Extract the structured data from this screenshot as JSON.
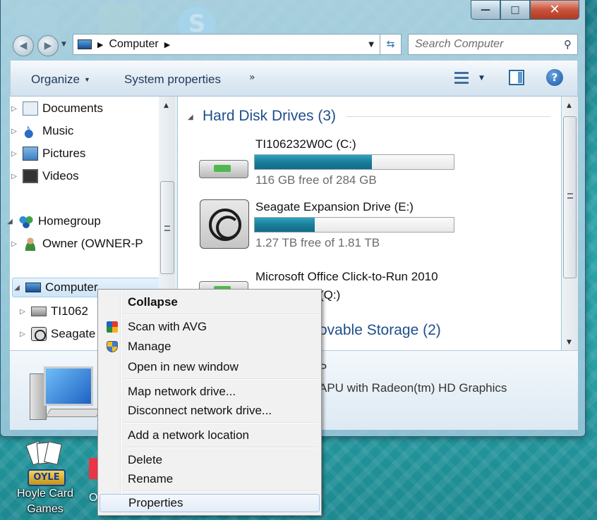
{
  "window": {
    "minimize_glyph": "—",
    "maximize_glyph": "□",
    "close_glyph": "✕"
  },
  "address_bar": {
    "crumbs": [
      "Computer"
    ],
    "search_placeholder": "Search Computer"
  },
  "toolbar": {
    "organize": "Organize",
    "system_properties": "System properties",
    "more": "»"
  },
  "nav_pane": {
    "items": [
      {
        "label": "Documents",
        "icon": "documents-icon"
      },
      {
        "label": "Music",
        "icon": "music-icon"
      },
      {
        "label": "Pictures",
        "icon": "pictures-icon"
      },
      {
        "label": "Videos",
        "icon": "videos-icon"
      },
      {
        "label": "Homegroup",
        "icon": "homegroup-icon"
      },
      {
        "label": "Owner (OWNER-P",
        "icon": "user-icon"
      },
      {
        "label": "Computer",
        "icon": "computer-icon"
      },
      {
        "label": "TI1062",
        "icon": "drive-icon"
      },
      {
        "label": "Seagate",
        "icon": "seagate-icon"
      }
    ]
  },
  "content": {
    "hard_disk_group": "Hard Disk Drives (3)",
    "removable_group": "ovable Storage (2)",
    "drives": [
      {
        "name": "TI106232W0C (C:)",
        "free": "116 GB free of 284 GB",
        "used_fraction": 0.59
      },
      {
        "name": "Seagate Expansion Drive (E:)",
        "free": "1.27 TB free of 1.81 TB",
        "used_fraction": 0.3
      },
      {
        "name": "Microsoft Office Click-to-Run 2010",
        "sub": "(Q:)"
      }
    ]
  },
  "details": {
    "line1": "P",
    "line2": "APU with Radeon(tm) HD Graphics"
  },
  "desktop": {
    "hoyle_label_1": "Hoyle Card",
    "hoyle_label_2": "Games",
    "hoyle_logo": "OYLE",
    "other_label": "O"
  },
  "context_menu": {
    "collapse": "Collapse",
    "scan_avg": "Scan with AVG",
    "manage": "Manage",
    "open_new_window": "Open in new window",
    "map_drive": "Map network drive...",
    "disconnect_drive": "Disconnect network drive...",
    "add_network_location": "Add a network location",
    "delete": "Delete",
    "rename": "Rename",
    "properties": "Properties"
  },
  "colors": {
    "accent": "#1e4e8c",
    "bar_fill": "#1a7d99",
    "desktop": "#27a0a6"
  }
}
